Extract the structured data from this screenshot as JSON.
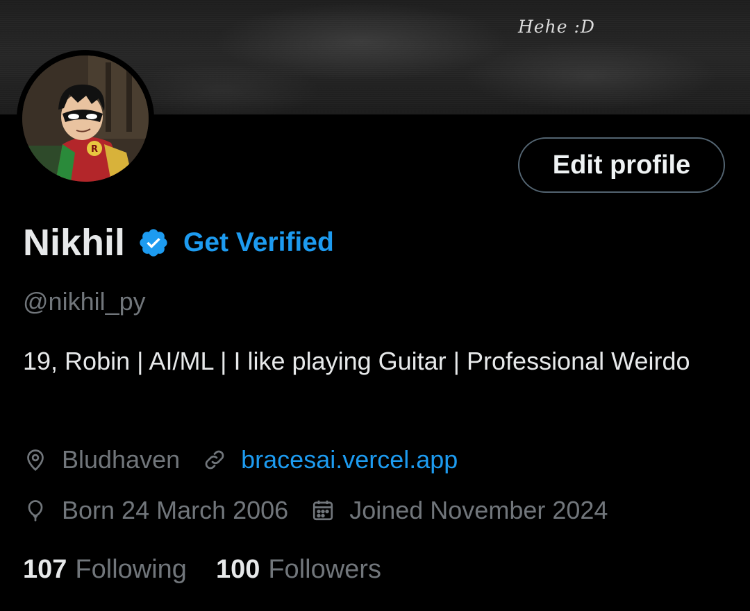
{
  "banner": {
    "text": "Hehe :D"
  },
  "profile": {
    "name": "Nikhil",
    "get_verified_label": "Get Verified",
    "handle": "@nikhil_py",
    "bio": "19, Robin | AI/ML | I like playing Guitar | Professional Weirdo",
    "location": "Bludhaven",
    "website": "bracesai.vercel.app",
    "birthday": "Born 24 March 2006",
    "joined": "Joined November 2024"
  },
  "actions": {
    "edit_profile_label": "Edit profile"
  },
  "stats": {
    "following_count": "107",
    "following_label": "Following",
    "followers_count": "100",
    "followers_label": "Followers"
  },
  "icons": {
    "verified": "verified-badge-icon",
    "location": "location-pin-icon",
    "website": "link-icon",
    "birthday": "balloon-icon",
    "joined": "calendar-icon"
  },
  "colors": {
    "background": "#000000",
    "text_primary": "#e7e9ea",
    "text_secondary": "#71767b",
    "accent": "#1d9bf0",
    "button_border": "#536471"
  }
}
